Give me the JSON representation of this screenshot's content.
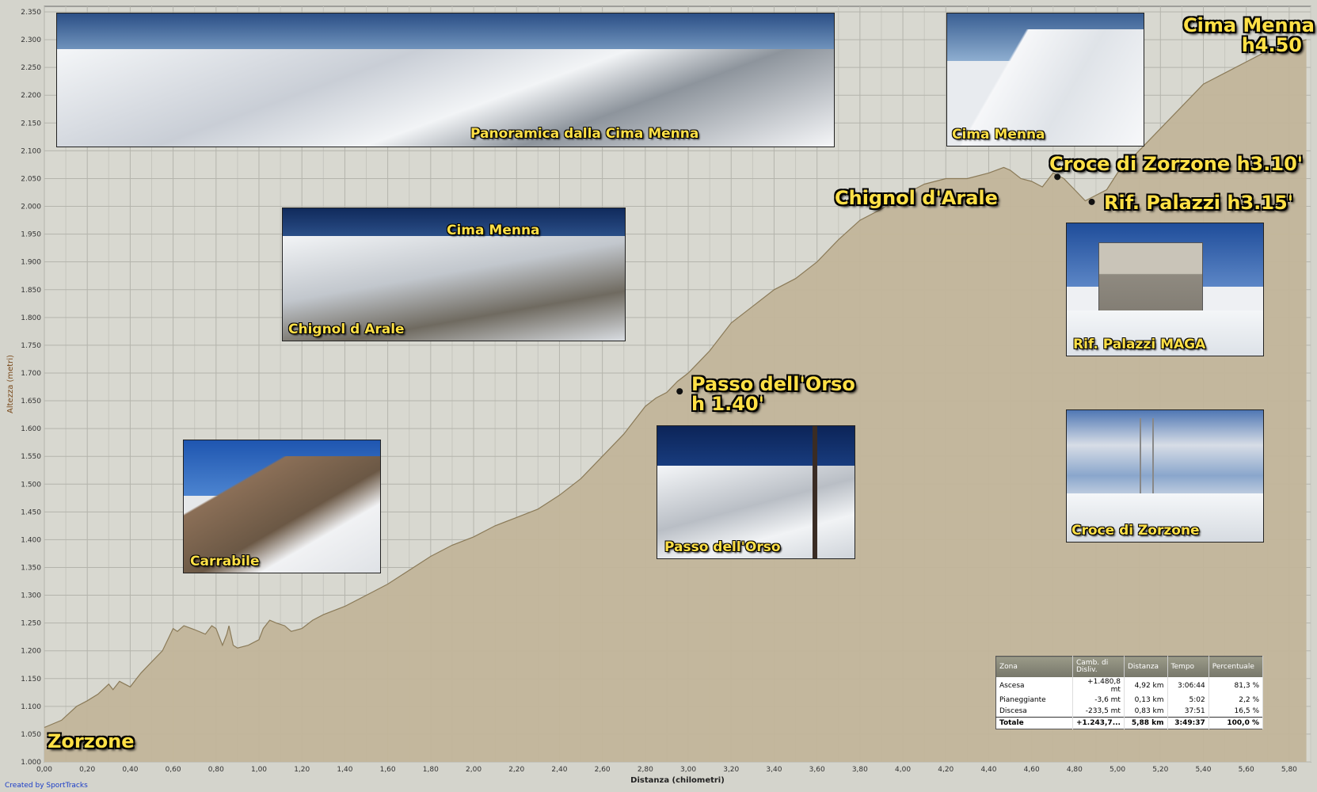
{
  "chart_data": {
    "type": "area",
    "xlabel": "Distanza (chilometri)",
    "ylabel": "Altezza (metri)",
    "xlim": [
      0,
      5.9
    ],
    "ylim": [
      1000,
      2360
    ],
    "xticks": [
      "0,00",
      "0,20",
      "0,40",
      "0,60",
      "0,80",
      "1,00",
      "1,20",
      "1,40",
      "1,60",
      "1,80",
      "2,00",
      "2,20",
      "2,40",
      "2,60",
      "2,80",
      "3,00",
      "3,20",
      "3,40",
      "3,60",
      "3,80",
      "4,00",
      "4,20",
      "4,40",
      "4,60",
      "4,80",
      "5,00",
      "5,20",
      "5,40",
      "5,60",
      "5,80"
    ],
    "yticks": [
      "1.000",
      "1.050",
      "1.100",
      "1.150",
      "1.200",
      "1.250",
      "1.300",
      "1.350",
      "1.400",
      "1.450",
      "1.500",
      "1.550",
      "1.600",
      "1.650",
      "1.700",
      "1.750",
      "1.800",
      "1.850",
      "1.900",
      "1.950",
      "2.000",
      "2.050",
      "2.100",
      "2.150",
      "2.200",
      "2.250",
      "2.300",
      "2.350"
    ],
    "grid": true,
    "fill_color": "#c2b59a",
    "line_color": "#8a7a58",
    "x": [
      0.0,
      0.08,
      0.15,
      0.2,
      0.25,
      0.3,
      0.32,
      0.35,
      0.4,
      0.43,
      0.45,
      0.5,
      0.55,
      0.6,
      0.62,
      0.65,
      0.7,
      0.75,
      0.78,
      0.8,
      0.82,
      0.83,
      0.85,
      0.86,
      0.88,
      0.9,
      0.95,
      1.0,
      1.02,
      1.05,
      1.08,
      1.12,
      1.15,
      1.2,
      1.25,
      1.3,
      1.4,
      1.5,
      1.6,
      1.7,
      1.8,
      1.9,
      2.0,
      2.1,
      2.2,
      2.3,
      2.4,
      2.5,
      2.6,
      2.7,
      2.8,
      2.85,
      2.9,
      2.95,
      3.0,
      3.1,
      3.2,
      3.3,
      3.4,
      3.5,
      3.6,
      3.7,
      3.8,
      3.9,
      4.0,
      4.1,
      4.2,
      4.3,
      4.4,
      4.47,
      4.5,
      4.55,
      4.6,
      4.65,
      4.7,
      4.75,
      4.8,
      4.85,
      4.9,
      4.95,
      5.0,
      5.1,
      5.2,
      5.3,
      5.4,
      5.5,
      5.6,
      5.7,
      5.8,
      5.88
    ],
    "y": [
      1062,
      1075,
      1100,
      1110,
      1122,
      1140,
      1130,
      1145,
      1135,
      1150,
      1160,
      1180,
      1200,
      1240,
      1235,
      1245,
      1238,
      1230,
      1245,
      1240,
      1220,
      1210,
      1230,
      1245,
      1210,
      1205,
      1210,
      1220,
      1240,
      1255,
      1250,
      1245,
      1235,
      1240,
      1255,
      1265,
      1280,
      1300,
      1320,
      1345,
      1370,
      1390,
      1405,
      1425,
      1440,
      1455,
      1480,
      1510,
      1550,
      1590,
      1640,
      1655,
      1665,
      1685,
      1700,
      1740,
      1790,
      1820,
      1850,
      1870,
      1900,
      1940,
      1975,
      1995,
      2020,
      2040,
      2050,
      2050,
      2060,
      2070,
      2065,
      2050,
      2045,
      2035,
      2060,
      2050,
      2030,
      2010,
      2020,
      2030,
      2060,
      2100,
      2140,
      2180,
      2220,
      2240,
      2260,
      2280,
      2290,
      2300
    ]
  },
  "annotations": {
    "zorzone": "Zorzone",
    "cima_menna": "Cima Menna\nh4.50",
    "chignol": "Chignol d'Arale",
    "croce": "Croce di Zorzone h3.10'",
    "palazzi": "Rif. Palazzi h3.15'",
    "passo": "Passo dell'Orso\nh 1.40'"
  },
  "photos": {
    "panorama": "Panoramica dalla Cima Menna",
    "cima_menna": "Cima Menna",
    "chignol_top": "Cima Menna",
    "chignol_bottom": "Chignol d Arale",
    "palazzi": "Rif. Palazzi  MAGA",
    "passo": "Passo dell'Orso",
    "croce": "Croce di Zorzone",
    "carrabile": "Carrabile"
  },
  "stats": {
    "headers": [
      "Zona",
      "Camb. di Disliv.",
      "Distanza",
      "Tempo",
      "Percentuale"
    ],
    "rows": [
      [
        "Ascesa",
        "+1.480,8 mt",
        "4,92 km",
        "3:06:44",
        "81,3 %"
      ],
      [
        "Pianeggiante",
        "-3,6 mt",
        "0,13 km",
        "5:02",
        "2,2 %"
      ],
      [
        "Discesa",
        "-233,5 mt",
        "0,83 km",
        "37:51",
        "16,5 %"
      ]
    ],
    "total": [
      "Totale",
      "+1.243,7...",
      "5,88 km",
      "3:49:37",
      "100,0 %"
    ]
  },
  "credit": "Created by SportTracks"
}
